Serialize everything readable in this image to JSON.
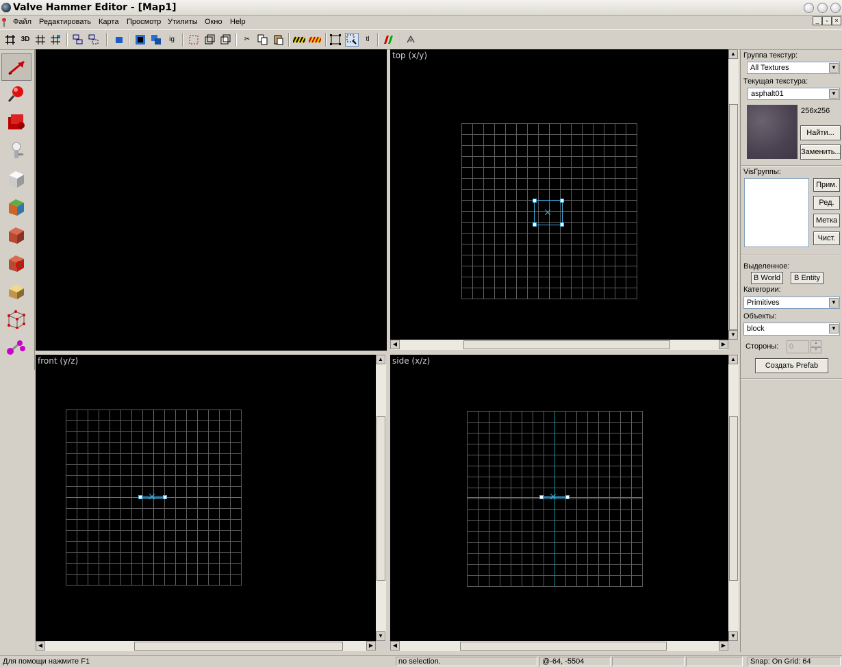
{
  "window": {
    "title": "Valve Hammer Editor - [Map1]"
  },
  "menu": [
    "Файл",
    "Редактировать",
    "Карта",
    "Просмотр",
    "Утилиты",
    "Окно",
    "Help"
  ],
  "toolbar": {
    "buttons": [
      "grid-icon",
      "3d-grid-icon",
      "grid-small-icon",
      "grid-large-icon",
      "group-icon",
      "ungroup-icon",
      "toggle-face-icon",
      "carve-icon",
      "hollow-icon",
      "ig-label",
      "texture-lock-icon",
      "paste-special-icon",
      "cut-icon",
      "copy-icon",
      "paste-icon",
      "hide-icon",
      "unhide-icon",
      "select-all-icon",
      "ignore-group-icon",
      "tl-label",
      "run-map-icon",
      "options-icon"
    ],
    "ig_text": "ig",
    "tl_text": "tl",
    "grid3d_text": "3D"
  },
  "tools": [
    "selection-tool",
    "magnify-tool",
    "camera-tool",
    "entity-tool",
    "block-tool",
    "texture-tool",
    "apply-texture-tool",
    "decal-tool",
    "clip-tool",
    "vertex-tool",
    "path-tool"
  ],
  "viewports": {
    "camera": {
      "label": ""
    },
    "top": {
      "label": "top (x/y)"
    },
    "front": {
      "label": "front (y/z)"
    },
    "side": {
      "label": "side (x/z)"
    }
  },
  "panel": {
    "texture_group_label": "Группа текстур:",
    "texture_group_value": "All Textures",
    "current_texture_label": "Текущая текстура:",
    "current_texture_value": "asphalt01",
    "texture_size": "256x256",
    "find_button": "Найти...",
    "replace_button": "Заменить...",
    "visgroups_label": "VisГруппы:",
    "visgroup_buttons": [
      "Прим.",
      "Ред.",
      "Метка",
      "Чист."
    ],
    "selected_label": "Выделенное:",
    "to_world_button": "В World",
    "to_entity_button": "В Entity",
    "categories_label": "Категории:",
    "categories_value": "Primitives",
    "objects_label": "Объекты:",
    "objects_value": "block",
    "sides_label": "Стороны:",
    "sides_value": "0",
    "create_prefab_button": "Создать Prefab"
  },
  "status": {
    "help": "Для помощи нажмите F1",
    "selection": "no selection.",
    "coords": "@-64, -5504",
    "snap": "Snap: On Grid: 64"
  },
  "colors": {
    "viewport_bg": "#000000",
    "grid": "#5e5e5e",
    "axis": "#1c8f93",
    "selection": "#3fb0e6",
    "chrome": "#d4d0c8"
  }
}
